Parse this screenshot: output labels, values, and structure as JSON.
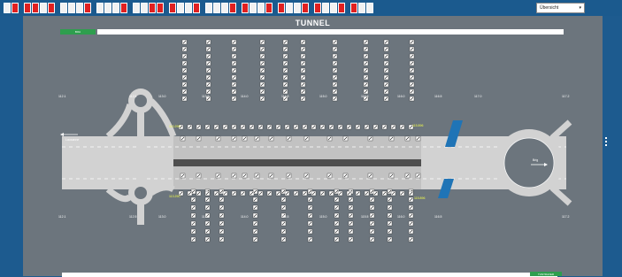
{
  "toolbar": {
    "groups": [
      {
        "name": "group-1",
        "pattern": [
          "w",
          "r"
        ]
      },
      {
        "name": "group-2",
        "pattern": [
          "r",
          "r",
          "w",
          "r"
        ]
      },
      {
        "name": "group-3",
        "pattern": [
          "w",
          "w",
          "w",
          "r"
        ]
      },
      {
        "name": "group-4",
        "pattern": [
          "w",
          "w",
          "w",
          "r"
        ]
      },
      {
        "name": "group-5",
        "pattern": [
          "w",
          "w",
          "r",
          "r"
        ]
      },
      {
        "name": "group-6",
        "pattern": [
          "r",
          "w",
          "w",
          "r"
        ]
      },
      {
        "name": "group-7",
        "pattern": [
          "w",
          "w",
          "w",
          "r"
        ]
      },
      {
        "name": "group-8",
        "pattern": [
          "r",
          "w",
          "w",
          "r"
        ]
      },
      {
        "name": "group-9",
        "pattern": [
          "r",
          "w",
          "w",
          "r"
        ]
      },
      {
        "name": "group-10",
        "pattern": [
          "r",
          "w",
          "w",
          "r"
        ]
      },
      {
        "name": "group-11",
        "pattern": [
          "r",
          "w",
          "w"
        ]
      }
    ]
  },
  "view_select": {
    "value": "Übersicht"
  },
  "header": {
    "title": "TUNNEL",
    "left_badge": "BOA"
  },
  "footer": {
    "right_badge": "TUNTRAVER"
  },
  "labels": {
    "direction_left": "Lausanne",
    "direction_right": "Brig",
    "station_left": "112.1",
    "station_right": "117.2",
    "stations_top": [
      "112.1",
      "112.5",
      "113.0",
      "113.5",
      "114.0",
      "114.5",
      "115.0",
      "115.5",
      "116.0",
      "116.5",
      "117.0",
      "117.2"
    ],
    "stations_bottom": [
      "112.1",
      "112.5",
      "113.0",
      "113.5",
      "114.0",
      "114.5",
      "115.0",
      "115.5",
      "116.0",
      "116.5",
      "117.2"
    ],
    "zone_top_left": "113.290",
    "zone_top_right": "115.896",
    "zone_bottom_left": "113.290",
    "zone_bottom_right": "115.896"
  },
  "colors": {
    "background": "#1d5b8f",
    "panel": "#6c757d",
    "road": "#d2d2d2",
    "water": "#1f74b6",
    "accent_green": "#2e9e4e",
    "alert_red": "#e02020"
  }
}
